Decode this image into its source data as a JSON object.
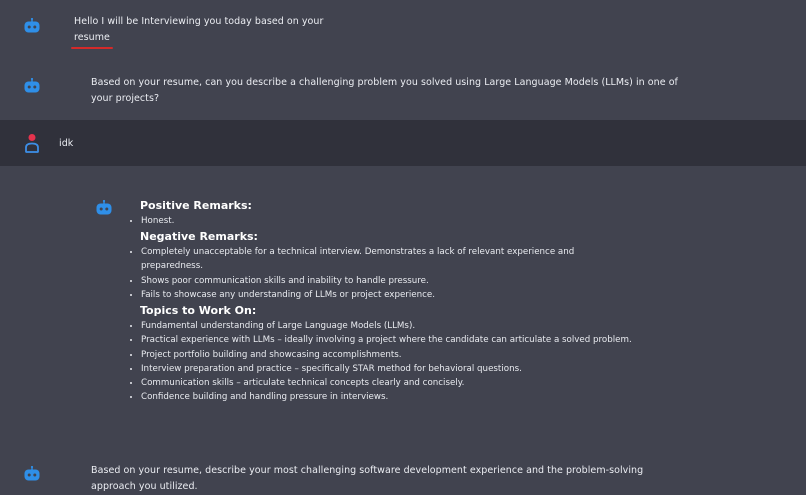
{
  "conversation": {
    "greeting": {
      "text_before": "Hello I will be Interviewing you today based on your",
      "highlighted_word": "resume"
    },
    "question1": {
      "text": "Based on your resume, can you describe a challenging problem you solved using Large Language Models (LLMs) in one of your projects?"
    },
    "user_reply": {
      "text": "idk"
    },
    "feedback": {
      "positive_title": "Positive Remarks:",
      "positive_items": [
        "Honest."
      ],
      "negative_title": "Negative Remarks:",
      "negative_items": [
        "Completely unacceptable for a technical interview. Demonstrates a lack of relevant experience and preparedness.",
        "Shows poor communication skills and inability to handle pressure.",
        "Fails to showcase any understanding of LLMs or project experience."
      ],
      "topics_title": "Topics to Work On:",
      "topics_items": [
        "Fundamental understanding of Large Language Models (LLMs).",
        "Practical experience with LLMs – ideally involving a project where the candidate can articulate a solved problem.",
        "Project portfolio building and showcasing accomplishments.",
        "Interview preparation and practice – specifically STAR method for behavioral questions.",
        "Communication skills – articulate technical concepts clearly and concisely.",
        "Confidence building and handling pressure in interviews."
      ]
    },
    "question2": {
      "text": "Based on your resume, describe your most challenging software development experience and the problem-solving approach you utilized."
    }
  },
  "colors": {
    "page_background": "#41434f",
    "user_row_background": "#30313b",
    "bot_icon_color": "#2f8fe8",
    "user_icon_head": "#e5334d",
    "user_icon_body": "#3d8ee6",
    "highlight_underline": "#d42a2a"
  },
  "icons": {
    "assistant": "robot-icon",
    "user": "user-person-icon"
  }
}
